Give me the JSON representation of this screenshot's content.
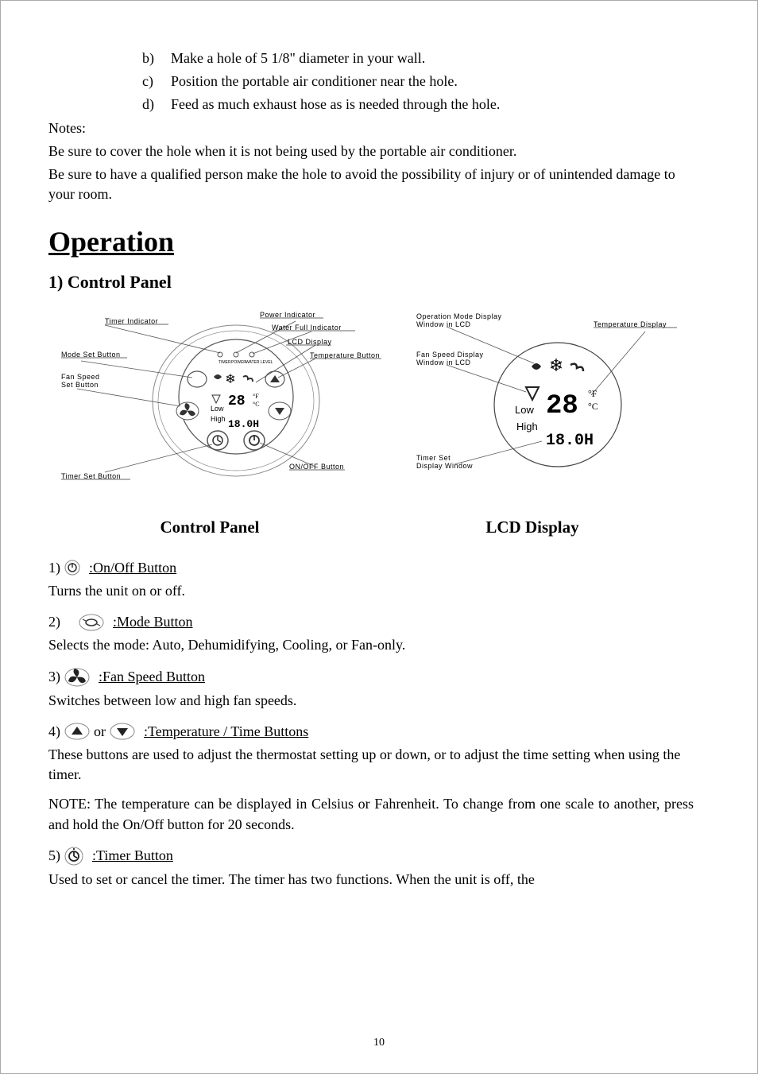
{
  "list_items": {
    "b": "Make a hole of 5 1/8\" diameter in your wall.",
    "c": "Position the portable air conditioner near the hole.",
    "d": "Feed as much exhaust hose as is needed through the hole."
  },
  "notes": {
    "heading": "Notes:",
    "p1": "Be sure to cover the hole when it is not being used by the portable air conditioner.",
    "p2": "Be sure to have a qualified person make the hole to avoid the possibility of injury or of unintended damage to your room."
  },
  "operation_heading": "Operation",
  "control_panel_heading": "1) Control Panel",
  "figure_left": {
    "callouts": {
      "timer_indicator": "Timer Indicator",
      "mode_set_button": "Mode Set Button",
      "fan_speed_set_button": "Fan Speed\nSet Button",
      "timer_set_button": "Timer Set Button",
      "power_indicator": "Power Indicator",
      "water_full_indicator": "Water Full Indicator",
      "lcd_display": "LCD Display",
      "temperature_button": "Temperature Button",
      "on_off_button": "ON/OFF Button",
      "power_label": "POWER",
      "timer_label": "TIMER",
      "water_level_label": "WATER LEVEL"
    },
    "display": {
      "low": "Low",
      "high": "High",
      "temp": "28",
      "temp_unit": "°F\n°C",
      "timer": "18.0H"
    }
  },
  "figure_right": {
    "callouts": {
      "operation_mode": "Operation Mode Display\nWindow in LCD",
      "fan_speed_display": "Fan Speed Display\nWindow in LCD",
      "timer_set_display": "Timer Set\nDisplay Window",
      "temperature_display": "Temperature Display"
    },
    "display": {
      "low": "Low",
      "high": "High",
      "temp": "28",
      "temp_unit": "°F\n°C",
      "timer": "18.0H"
    }
  },
  "captions": {
    "control_panel": "Control Panel",
    "lcd_display": "LCD Display"
  },
  "buttons": [
    {
      "num": "1)",
      "name": ":On/Off   Button",
      "desc": "Turns the unit on or off."
    },
    {
      "num": "2)",
      "name": ":Mode Button",
      "desc": "Selects the mode: Auto, Dehumidifying, Cooling, or Fan-only."
    },
    {
      "num": "3)",
      "name": ":Fan Speed Button",
      "desc": "Switches between low and high fan speeds."
    }
  ],
  "button4": {
    "num": "4)",
    "or": "or",
    "name": ":Temperature / Time Buttons",
    "desc": "These buttons are used to adjust the thermostat setting up or down, or to adjust the time setting when using the timer.",
    "note": "NOTE: The temperature can be displayed in Celsius or Fahrenheit. To change from one scale to another, press and hold the On/Off button for 20 seconds."
  },
  "button5": {
    "num": "5)",
    "name": ":Timer Button",
    "desc": "Used to set or cancel the timer. The timer has two functions. When the unit is off, the"
  },
  "page_number": "10"
}
